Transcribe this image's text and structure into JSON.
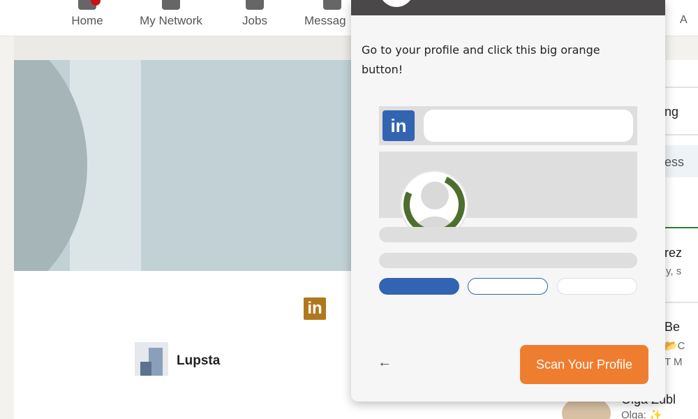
{
  "nav": {
    "items": [
      {
        "label": "Home",
        "icon": "home-icon"
      },
      {
        "label": "My Network",
        "icon": "network-icon"
      },
      {
        "label": "Jobs",
        "icon": "briefcase-icon"
      },
      {
        "label": "Messag",
        "icon": "message-icon"
      }
    ],
    "partial_label": "A"
  },
  "profile": {
    "company_logo_text": "in",
    "company_name": "Lupsta"
  },
  "sidebar": {
    "fragments": [
      "ng",
      "ess",
      "rez",
      "y, s",
      "Be",
      "📂C",
      "T M",
      "Olga Zubl",
      "Olga: ✨"
    ]
  },
  "popup": {
    "instruction": "Go to your profile and click this big orange button!",
    "mock_logo_text": "in",
    "back_symbol": "←",
    "scan_button_label": "Scan Your Profile"
  },
  "colors": {
    "popup_header": "#4a4848",
    "linkedin_blue": "#3264b2",
    "scan_orange": "#ef7d2f",
    "ring_green": "#4e6e2e"
  }
}
